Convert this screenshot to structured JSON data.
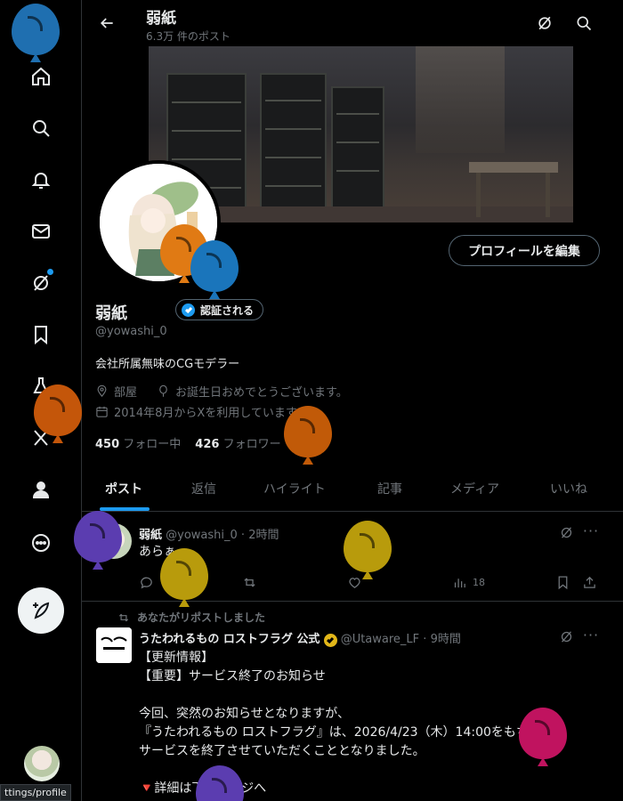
{
  "header": {
    "title": "弱紙",
    "post_count": "6.3万 件のポスト"
  },
  "nav": {
    "items": [
      "x-logo",
      "home",
      "explore",
      "notifications",
      "messages",
      "grok",
      "bookmarks",
      "labs",
      "premium",
      "profile",
      "more"
    ],
    "status_url": "ttings/profile"
  },
  "profile": {
    "name": "弱紙",
    "verify_label": "認証される",
    "handle": "@yowashi_0",
    "bio": "会社所属無味のCGモデラー",
    "location": "部屋",
    "birthday": "お誕生日おめでとうございます。",
    "joined": "2014年8月からXを利用しています",
    "following_count": "450",
    "following_label": "フォロー中",
    "followers_count": "426",
    "followers_label": "フォロワー",
    "edit_label": "プロフィールを編集"
  },
  "tabs": [
    "ポスト",
    "返信",
    "ハイライト",
    "記事",
    "メディア",
    "いいね"
  ],
  "posts": [
    {
      "name": "弱紙",
      "handle": "@yowashi_0",
      "time": "2時間",
      "text": "あらぁ",
      "views": "18"
    },
    {
      "repost_label": "あなたがリポストしました",
      "name": "うたわれるもの ロストフラグ 公式",
      "handle": "@Utaware_LF",
      "time": "9時間",
      "text": "【更新情報】\n【重要】サービス終了のお知らせ\n\n今回、突然のお知らせとなりますが、\n『うたわれるもの ロストフラグ』は、2026/4/23（木）14:00をもちまして\nサービスを終了させていただくこととなりました。\n\n🔻詳細は下記ページへ"
    }
  ],
  "colors": {
    "accent": "#1d9bf0",
    "balloons": [
      "#1f6fb0",
      "#e07a14",
      "#1a75bb",
      "#c4560a",
      "#c15a08",
      "#5b3db0",
      "#b89b0c",
      "#b89b0c",
      "#c0135f",
      "#5b3db0"
    ]
  }
}
